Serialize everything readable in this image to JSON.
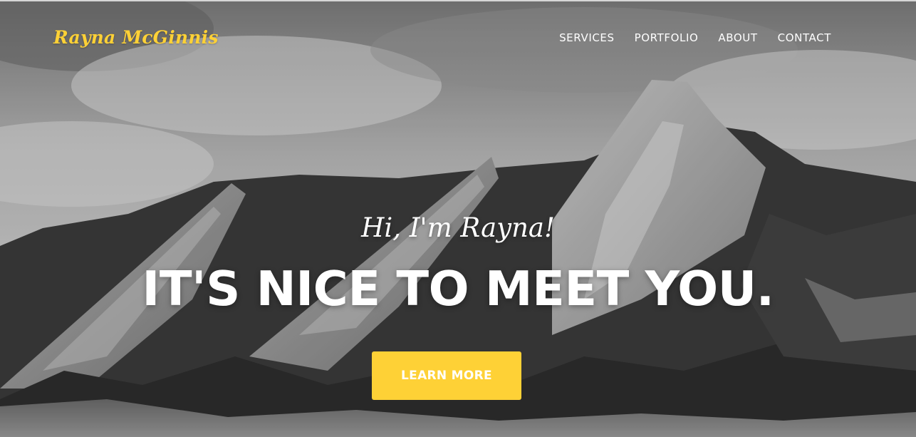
{
  "navbar": {
    "brand": "Rayna McGinnis",
    "items": [
      {
        "label": "SERVICES"
      },
      {
        "label": "PORTFOLIO"
      },
      {
        "label": "ABOUT"
      },
      {
        "label": "CONTACT"
      }
    ]
  },
  "hero": {
    "subheading": "Hi, I'm Rayna!",
    "heading": "IT'S NICE TO MEET YOU.",
    "button_label": "LEARN MORE",
    "background": "black-and-white mountain photo"
  },
  "colors": {
    "accent": "#fed136",
    "text": "#ffffff"
  }
}
